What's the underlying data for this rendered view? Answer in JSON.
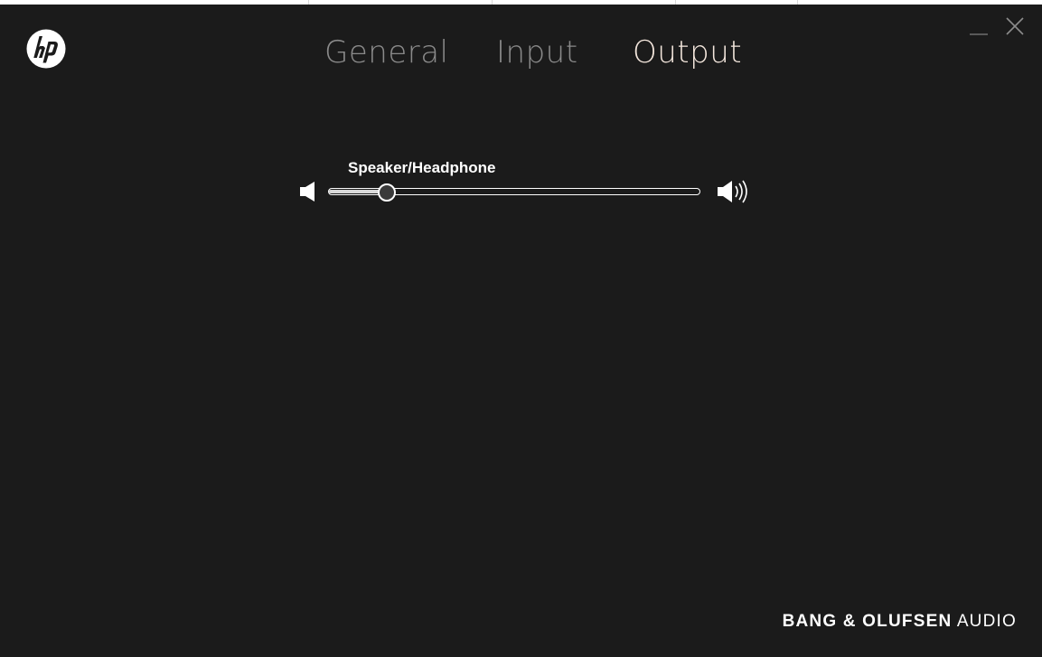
{
  "app": {
    "logo": "hp-logo-icon"
  },
  "tabs": [
    {
      "label": "General",
      "active": false
    },
    {
      "label": "Input",
      "active": false
    },
    {
      "label": "Output",
      "active": true
    }
  ],
  "window_controls": {
    "minimize_icon": "minimize-icon",
    "close_icon": "close-icon"
  },
  "output": {
    "device_label": "Speaker/Headphone",
    "volume_fraction": 0.155,
    "min_icon": "speaker-mute-icon",
    "max_icon": "speaker-loud-icon"
  },
  "footer": {
    "brand_bold": "BANG & OLUFSEN",
    "brand_light": "AUDIO"
  },
  "colors": {
    "background": "#1b1b1b",
    "tab_inactive": "#8a8a8a",
    "tab_active": "#f3e6dc",
    "text": "#ffffff"
  }
}
